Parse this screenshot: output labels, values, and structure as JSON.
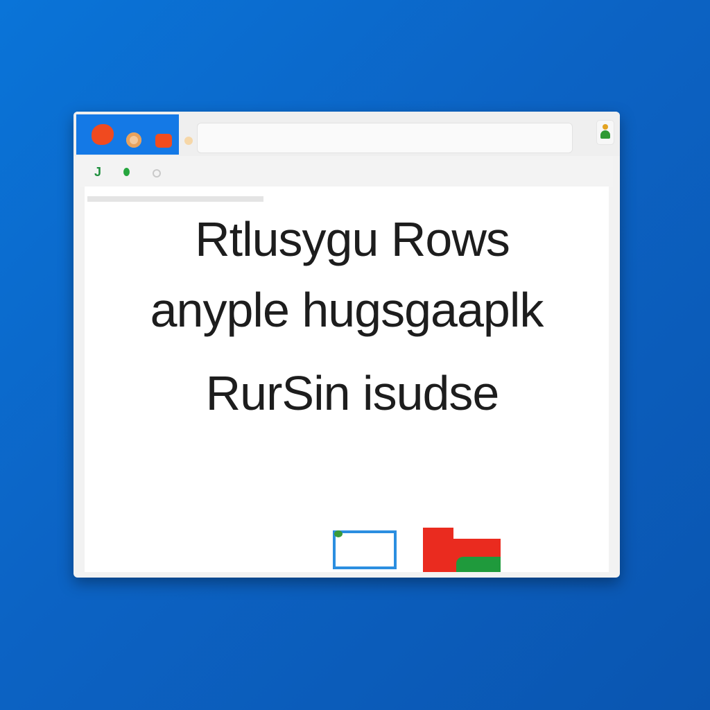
{
  "window": {
    "controls": {
      "close_icon": "close-dot-icon",
      "minimize_icon": "minimize-dot-icon",
      "maximize_icon": "maximize-dot-icon"
    },
    "address_bar": {
      "value": "",
      "placeholder": ""
    },
    "profile_icon": "user-profile-icon"
  },
  "toolbar": {
    "back_glyph": "J",
    "forward_icon": "forward-dot-icon",
    "reload_icon": "reload-icon"
  },
  "content": {
    "lines": [
      "Rtlusygu Rows",
      "anyple hugsgaaplk",
      "RurSin isudse"
    ]
  },
  "colors": {
    "desktop": "#0c63c4",
    "titlebar_accent": "#1479e6",
    "close": "#f04a1f",
    "thumb_blue": "#2b8ee0",
    "thumb_red": "#ea2b1f",
    "thumb_green": "#1f9a3c"
  }
}
